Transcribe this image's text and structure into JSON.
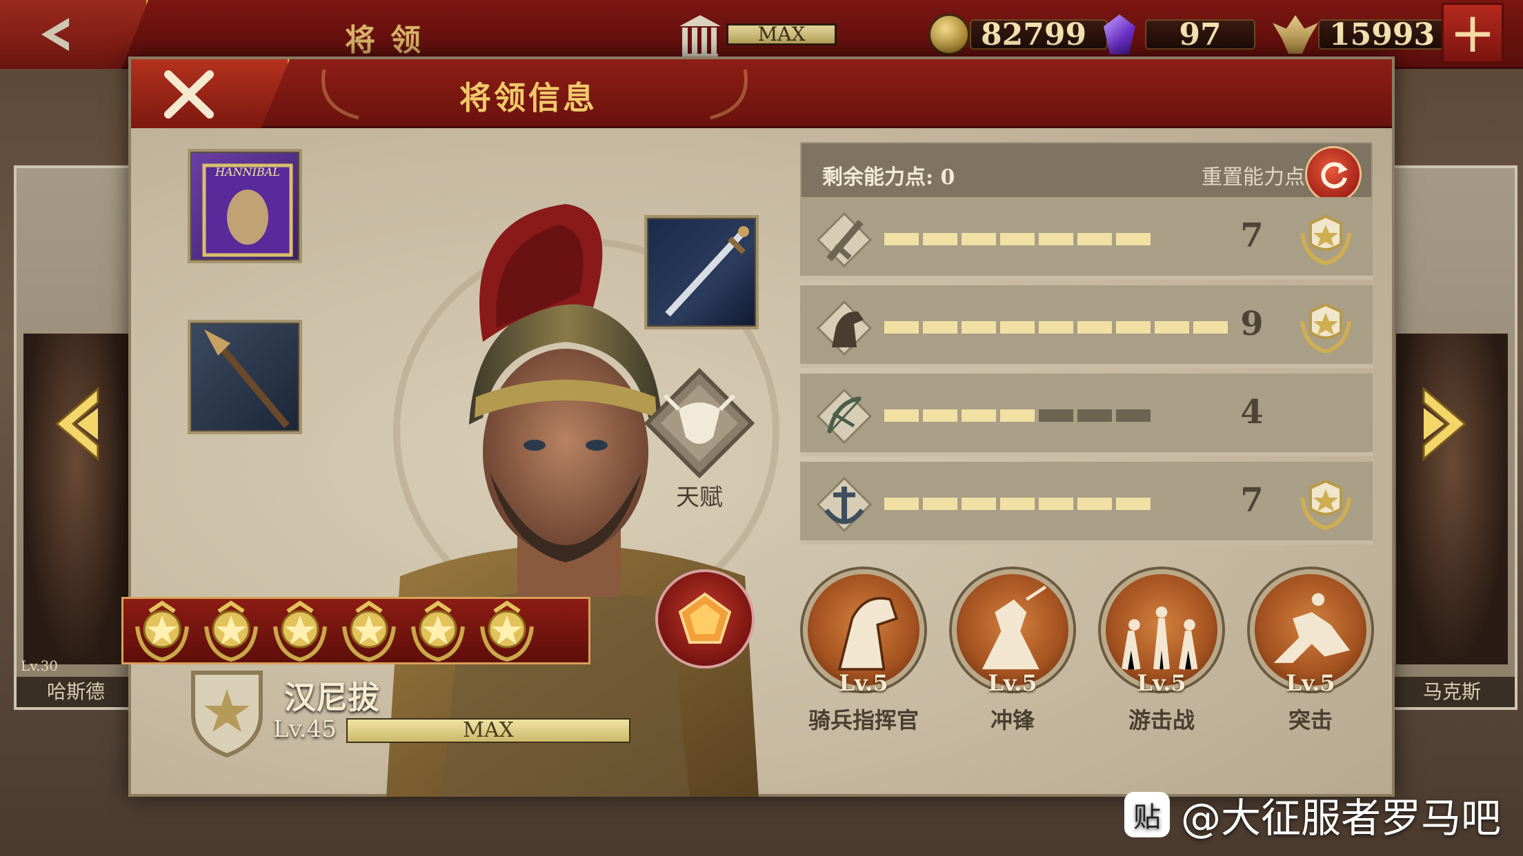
{
  "topbar": {
    "screen_title": "将领",
    "max_label": "MAX",
    "coins": "82799",
    "gems": "97",
    "honor": "15993",
    "plus": "+"
  },
  "dialog": {
    "title": "将领信息"
  },
  "side": {
    "left_name": "哈斯德",
    "left_level": "Lv.30",
    "right_name": "马克斯"
  },
  "equipment": {
    "banner_text": "HANNIBAL"
  },
  "talent": {
    "label": "天赋"
  },
  "hero": {
    "name": "汉尼拔",
    "level": "Lv.45",
    "exp_label": "MAX",
    "stars": 6
  },
  "ability": {
    "remaining_label": "剩余能力点: 0",
    "reset_label": "重置能力点"
  },
  "stats": [
    {
      "icon": "infantry-sword-icon",
      "value": "7",
      "max": 7,
      "medal": true
    },
    {
      "icon": "cavalry-horse-icon",
      "value": "9",
      "max": 9,
      "medal": true
    },
    {
      "icon": "archery-bow-icon",
      "value": "4",
      "max": 7,
      "medal": false
    },
    {
      "icon": "navy-anchor-icon",
      "value": "7",
      "max": 7,
      "medal": true
    }
  ],
  "skills": [
    {
      "level": "Lv.5",
      "name": "骑兵指挥官"
    },
    {
      "level": "Lv.5",
      "name": "冲锋"
    },
    {
      "level": "Lv.5",
      "name": "游击战"
    },
    {
      "level": "Lv.5",
      "name": "突击"
    }
  ],
  "watermark": {
    "text": "@大征服者罗马吧",
    "icon_text": "贴"
  },
  "colors": {
    "header_red": "#8e1e16",
    "gold": "#f2c96a",
    "panel": "#a99e86",
    "bar_on": "#f0e0a4",
    "bar_off": "#6e6452"
  }
}
